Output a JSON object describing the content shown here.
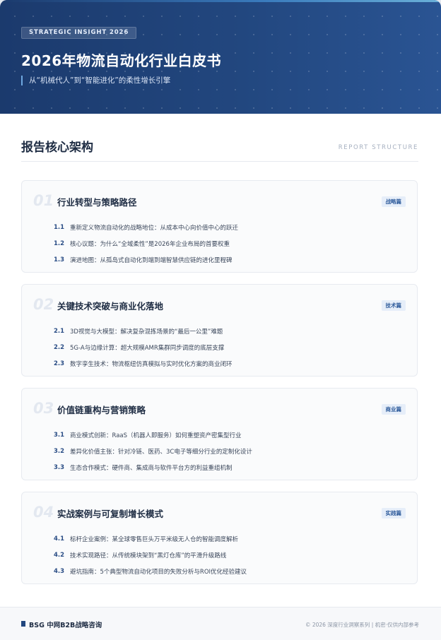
{
  "hero": {
    "tag": "STRATEGIC INSIGHT 2026",
    "title": "2026年物流自动化行业白皮书",
    "subtitle": "从“机械代人”到“智能进化”的柔性增长引擎"
  },
  "section": {
    "title": "报告核心架构",
    "title_en": "REPORT STRUCTURE"
  },
  "chapters": [
    {
      "num": "01",
      "title": "行业转型与策略路径",
      "badge": "战略篇",
      "items": [
        {
          "no": "1.1",
          "text": "重新定义物流自动化的战略地位：从成本中心向价值中心的跃迁"
        },
        {
          "no": "1.2",
          "text": "核心议题：为什么“全域柔性”是2026年企业布局的首要权重"
        },
        {
          "no": "1.3",
          "text": "演进地图：从孤岛式自动化到端到端智慧供应链的进化里程碑"
        }
      ]
    },
    {
      "num": "02",
      "title": "关键技术突破与商业化落地",
      "badge": "技术篇",
      "items": [
        {
          "no": "2.1",
          "text": "3D视觉与大模型：解决复杂混拣场景的“最后一公里”难题"
        },
        {
          "no": "2.2",
          "text": "5G-A与边缘计算：超大规模AMR集群同步调度的底层支撑"
        },
        {
          "no": "2.3",
          "text": "数字孪生技术：物流枢纽仿真模拟与实时优化方案的商业闭环"
        }
      ]
    },
    {
      "num": "03",
      "title": "价值链重构与营销策略",
      "badge": "商业篇",
      "items": [
        {
          "no": "3.1",
          "text": "商业模式创新：RaaS（机器人即服务）如何重塑资产密集型行业"
        },
        {
          "no": "3.2",
          "text": "差异化价值主张：针对冷链、医药、3C电子等细分行业的定制化设计"
        },
        {
          "no": "3.3",
          "text": "生态合作模式：硬件商、集成商与软件平台方的利益重组机制"
        }
      ]
    },
    {
      "num": "04",
      "title": "实战案例与可复制增长模式",
      "badge": "实践篇",
      "items": [
        {
          "no": "4.1",
          "text": "标杆企业案例：某全球零售巨头万平米级无人仓的智能调度解析"
        },
        {
          "no": "4.2",
          "text": "技术实现路径：从传统模块架到“黑灯仓库”的平滑升级路线"
        },
        {
          "no": "4.3",
          "text": "避坑指南：5个典型物流自动化项目的失败分析与ROI优化经验建议"
        }
      ]
    }
  ],
  "footer": {
    "brand": "BSG 中网B2B战略咨询",
    "copyright": "© 2026 深度行业洞察系列 | 机密·仅供内部参考"
  }
}
